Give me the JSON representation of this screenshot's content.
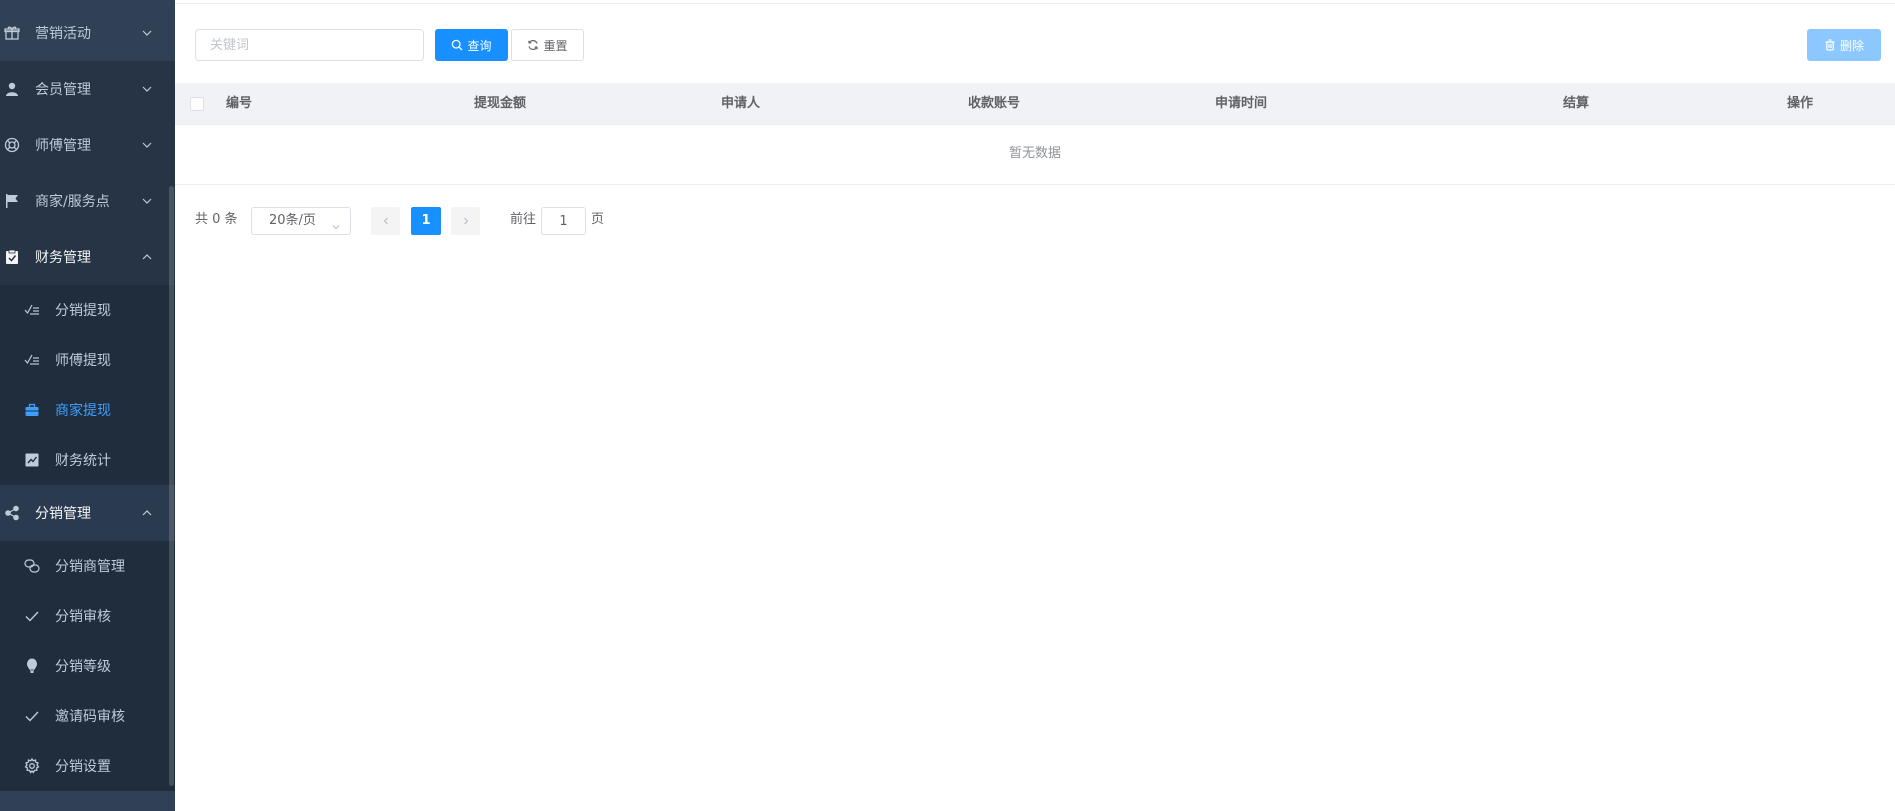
{
  "colors": {
    "sidebar_bg": "#304156",
    "primary": "#1890ff",
    "active_menu": "#409eff",
    "menu_text": "#bfcbd9"
  },
  "sidebar": {
    "menus": [
      {
        "label": "营销活动",
        "icon": "gift-icon",
        "expanded": false
      },
      {
        "label": "会员管理",
        "icon": "user-icon",
        "expanded": false
      },
      {
        "label": "师傅管理",
        "icon": "support-ring-icon",
        "expanded": false
      },
      {
        "label": "商家/服务点",
        "icon": "flag-icon",
        "expanded": false
      },
      {
        "label": "财务管理",
        "icon": "clipboard-check-icon",
        "expanded": true,
        "children": [
          {
            "label": "分销提现",
            "icon": "checklist-icon"
          },
          {
            "label": "师傅提现",
            "icon": "checklist-icon"
          },
          {
            "label": "商家提现",
            "icon": "briefcase-icon",
            "active": true
          },
          {
            "label": "财务统计",
            "icon": "line-chart-icon"
          }
        ]
      },
      {
        "label": "分销管理",
        "icon": "share-icon",
        "expanded": true,
        "children": [
          {
            "label": "分销商管理",
            "icon": "chat-bubbles-icon"
          },
          {
            "label": "分销审核",
            "icon": "check-icon"
          },
          {
            "label": "分销等级",
            "icon": "hot-air-balloon-icon"
          },
          {
            "label": "邀请码审核",
            "icon": "check-icon"
          },
          {
            "label": "分销设置",
            "icon": "gear-icon"
          }
        ]
      }
    ]
  },
  "toolbar": {
    "search_placeholder": "关键词",
    "search_value": "",
    "query_label": "查询",
    "reset_label": "重置",
    "delete_label": "删除"
  },
  "table": {
    "columns": [
      "编号",
      "提现金额",
      "申请人",
      "收款账号",
      "申请时间",
      "结算",
      "操作"
    ],
    "rows": [],
    "empty_text": "暂无数据"
  },
  "pagination": {
    "total_text": "共 0 条",
    "page_size": "20条/页",
    "current_page": "1",
    "goto_label": "前往",
    "goto_value": "1",
    "page_suffix": "页"
  }
}
